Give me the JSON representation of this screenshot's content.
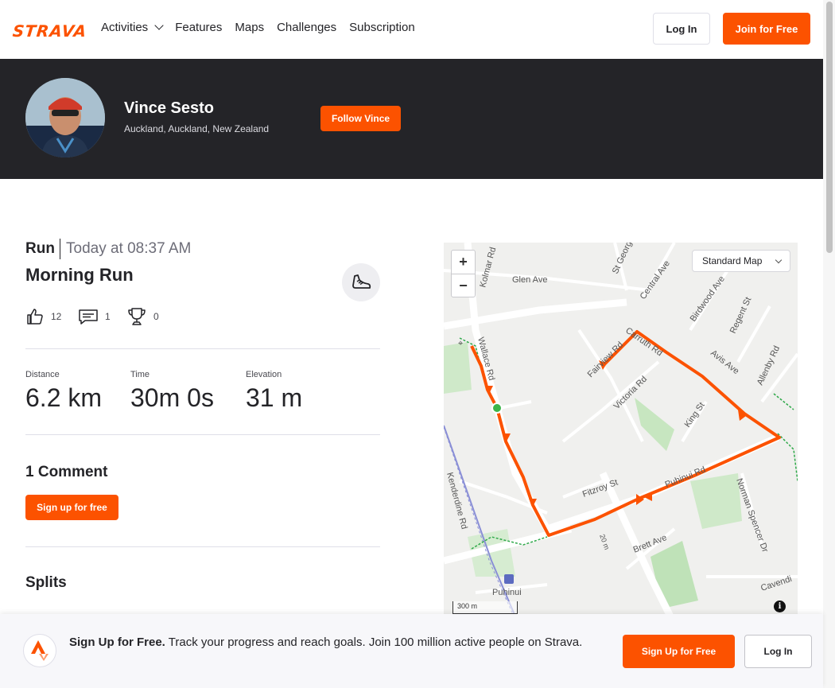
{
  "brand": {
    "logo_text": "STRAVA",
    "accent_color": "#fc5200"
  },
  "nav": {
    "items": [
      "Activities",
      "Features",
      "Maps",
      "Challenges",
      "Subscription"
    ],
    "login_label": "Log In",
    "join_label": "Join for Free"
  },
  "athlete": {
    "name": "Vince Sesto",
    "location": "Auckland, Auckland, New Zealand",
    "follow_label": "Follow Vince"
  },
  "activity": {
    "type": "Run",
    "when": "Today at 08:37 AM",
    "name": "Morning Run",
    "kudos": "12",
    "comments": "1",
    "achievements": "0",
    "stats": [
      {
        "label": "Distance",
        "value": "6.2 km"
      },
      {
        "label": "Time",
        "value": "30m 0s"
      },
      {
        "label": "Elevation",
        "value": "31 m"
      }
    ]
  },
  "comments": {
    "heading": "1 Comment",
    "signup_label": "Sign up for free"
  },
  "splits": {
    "heading": "Splits"
  },
  "map": {
    "type_label": "Standard Map",
    "scale_label": "300 m",
    "zoom_in": "+",
    "zoom_out": "−",
    "info_symbol": "i",
    "street_labels": [
      "Kolmar Rd",
      "Glen Ave",
      "St George",
      "Central Ave",
      "Birdwood Ave",
      "Regent St",
      "Wallace Rd",
      "Fairview Rd",
      "Carruth Rd",
      "Avis Ave",
      "Allenby Rd",
      "Victoria Rd",
      "King St",
      "Kenderdine Rd",
      "Fitzroy St",
      "Puhinui Rd",
      "Norman Spencer Dr",
      "Brett Ave",
      "Cavendi",
      "Puhinui",
      "20 m"
    ],
    "route_color": "#fc5200"
  },
  "cta": {
    "headline": "Sign Up for Free.",
    "body": "Track your progress and reach goals. Join 100 million active people on Strava.",
    "signup_label": "Sign Up for Free",
    "login_label": "Log In"
  }
}
